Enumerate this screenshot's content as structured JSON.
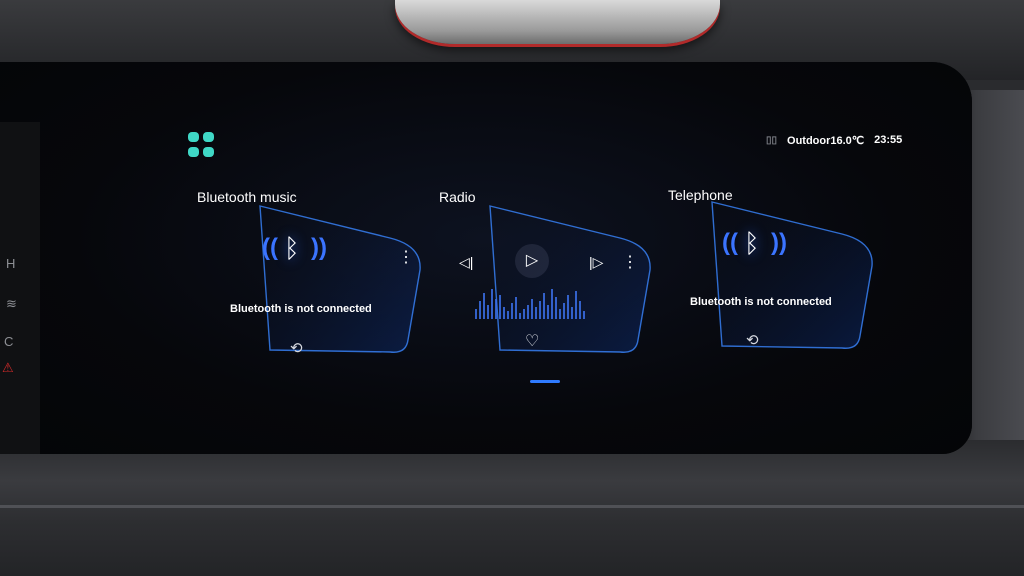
{
  "status_bar": {
    "signal_icon": "signal-icon",
    "outdoor_temp": "Outdoor16.0℃",
    "time": "23:55"
  },
  "launcher": {
    "icon": "apps-grid-icon",
    "accent": "#3fd8c6"
  },
  "cards": {
    "bluetooth_music": {
      "title": "Bluetooth music",
      "status": "Bluetooth is not connected",
      "icons": [
        "bluetooth-icon",
        "more-icon",
        "reconnect-icon"
      ]
    },
    "radio": {
      "title": "Radio",
      "icons": [
        "previous-icon",
        "play-icon",
        "next-icon",
        "more-icon",
        "favorite-icon"
      ]
    },
    "telephone": {
      "title": "Telephone",
      "status": "Bluetooth is not connected",
      "icons": [
        "bluetooth-icon",
        "reconnect-icon"
      ]
    }
  },
  "side_controls": {
    "hot_label": "H",
    "cold_label": "C"
  },
  "colors": {
    "accent_blue": "#2f7bff",
    "card_edge": "#3a86ff",
    "warning_red": "#d42a2a"
  }
}
